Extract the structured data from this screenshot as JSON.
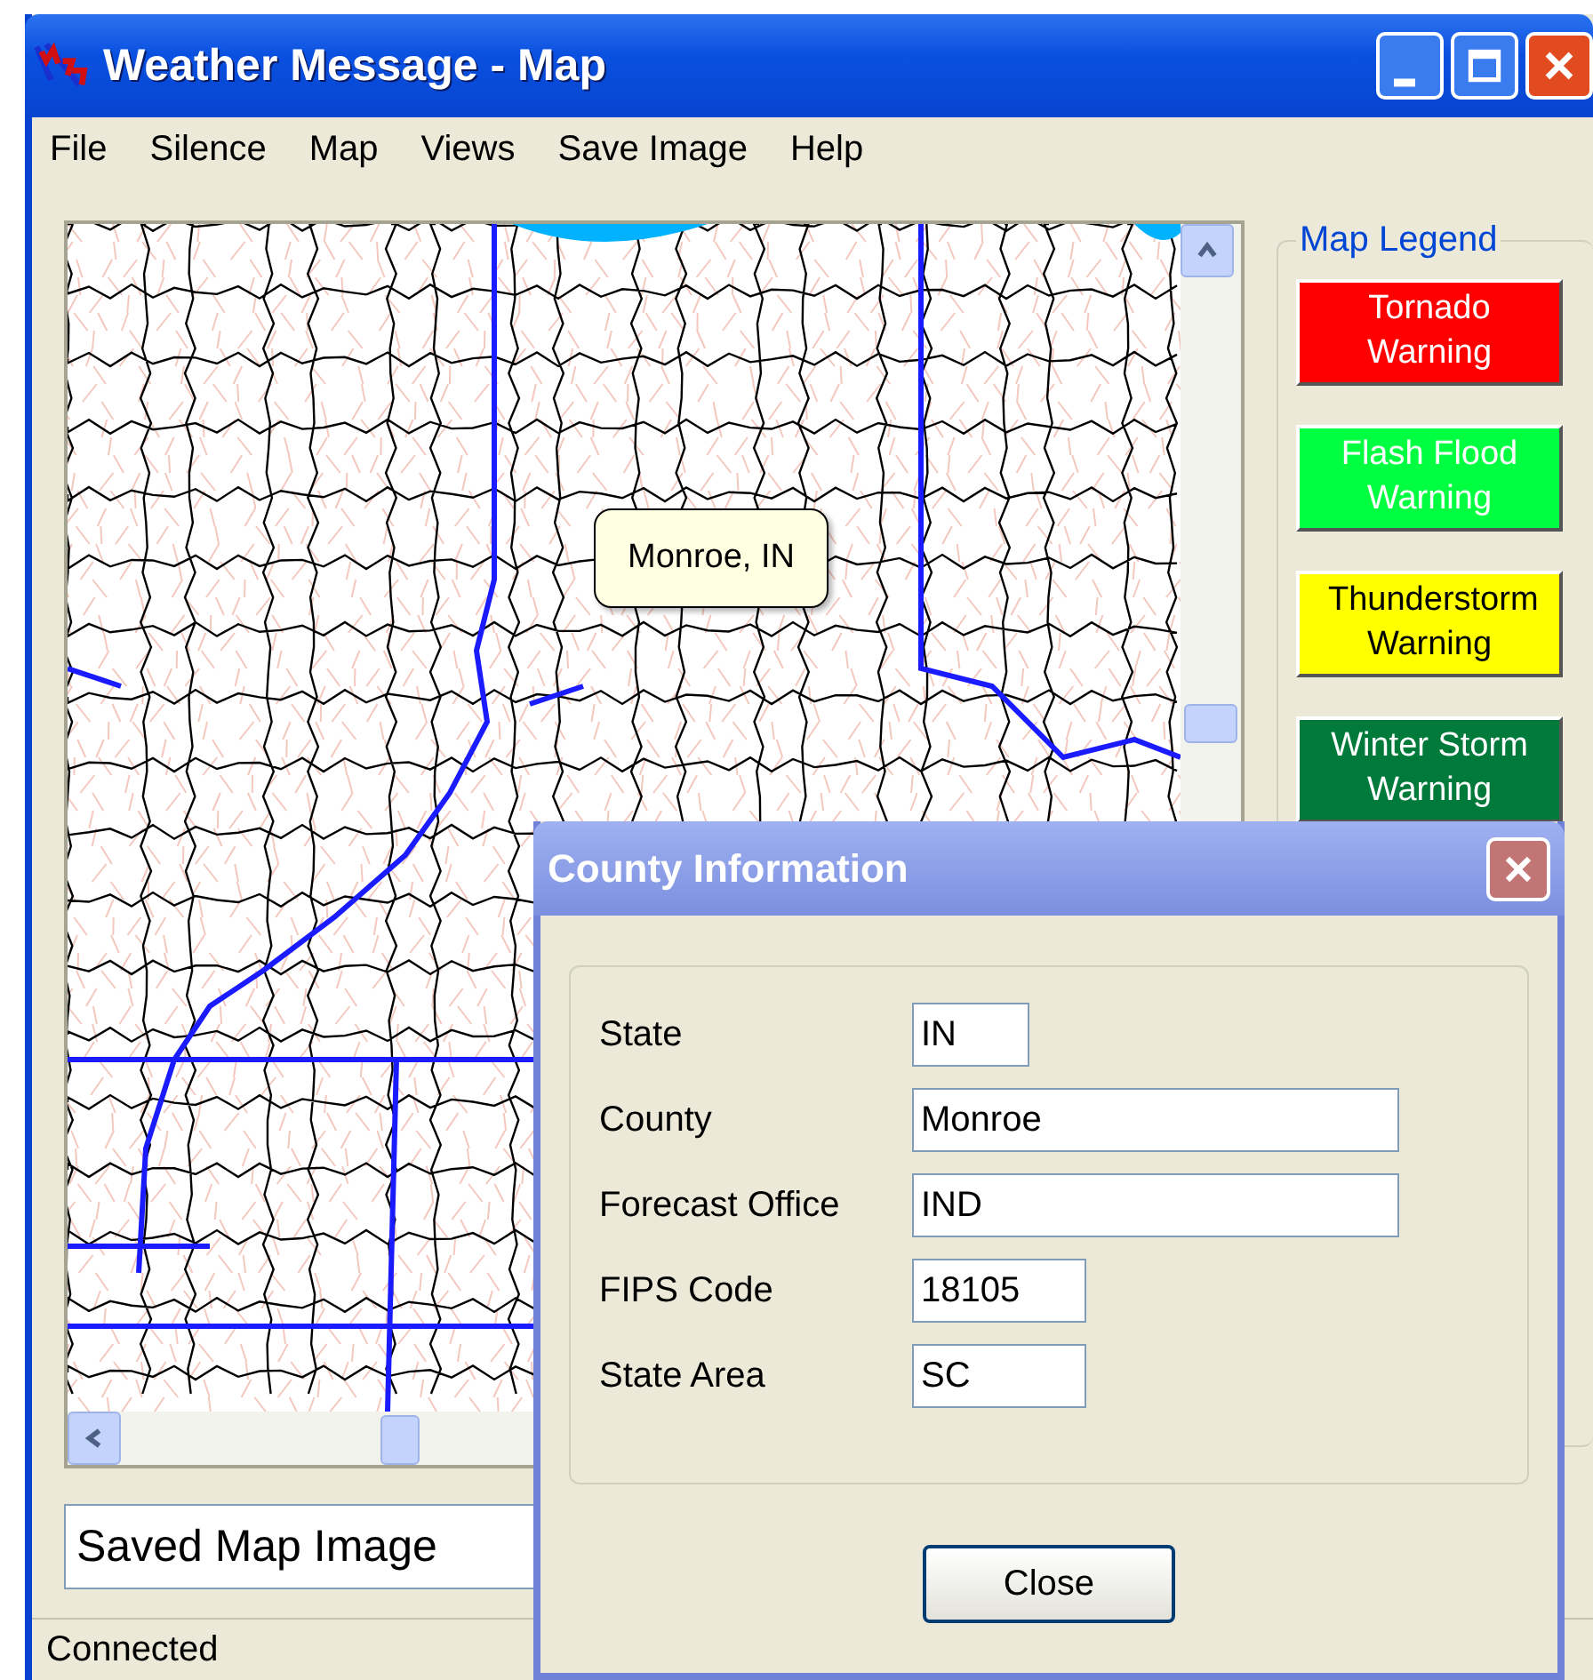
{
  "window": {
    "title": "Weather Message - Map"
  },
  "menu": [
    {
      "label": "File"
    },
    {
      "label": "Silence"
    },
    {
      "label": "Map"
    },
    {
      "label": "Views"
    },
    {
      "label": "Save Image"
    },
    {
      "label": "Help"
    }
  ],
  "map": {
    "tooltip": "Monroe, IN"
  },
  "legend": {
    "title": "Map Legend",
    "items": [
      {
        "label": "Tornado Warning",
        "color": "#ff0000"
      },
      {
        "label": "Flash Flood Warning",
        "color": "#00ff40"
      },
      {
        "label": "Thunderstorm Warning",
        "color": "#ffff00"
      },
      {
        "label": "Winter Storm Warning",
        "color": "#007a3a"
      }
    ]
  },
  "image_field": {
    "value": "Saved Map Image"
  },
  "status_bar": {
    "text": "Connected"
  },
  "dialog": {
    "title": "County Information",
    "fields": [
      {
        "label": "State",
        "value": "IN"
      },
      {
        "label": "County",
        "value": "Monroe"
      },
      {
        "label": "Forecast Office",
        "value": "IND"
      },
      {
        "label": "FIPS Code",
        "value": "18105"
      },
      {
        "label": "State Area",
        "value": "SC"
      }
    ],
    "button": "Close"
  }
}
